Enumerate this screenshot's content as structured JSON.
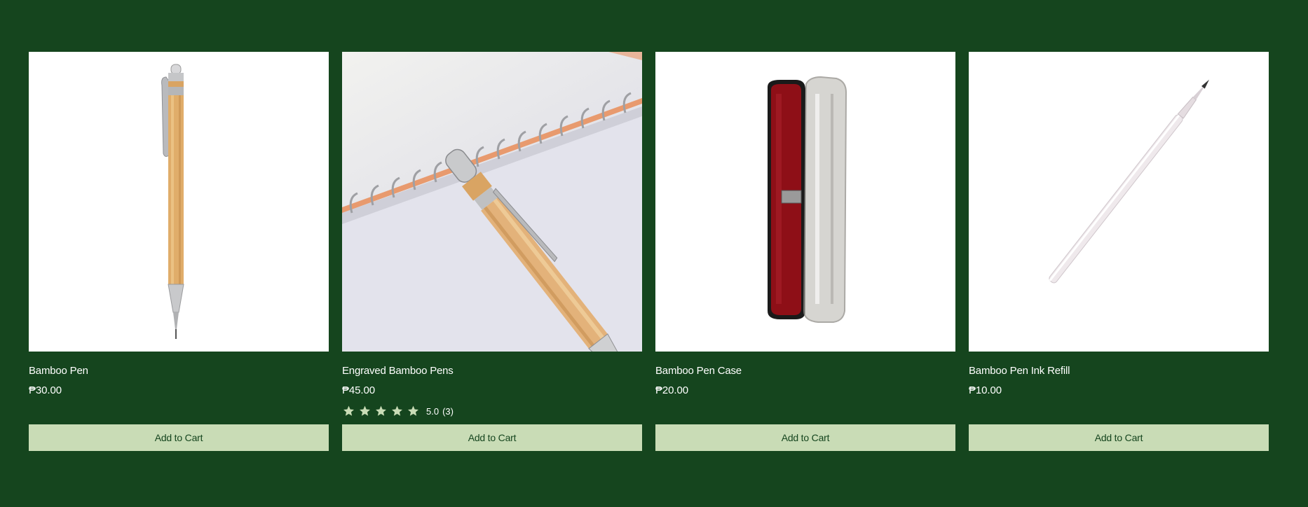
{
  "products": [
    {
      "name": "Bamboo Pen",
      "price": "₱30.00",
      "image": "bamboo-pen-image",
      "cart_label": "Add to Cart"
    },
    {
      "name": "Engraved Bamboo Pens",
      "price": "₱45.00",
      "image": "engraved-bamboo-pen-image",
      "rating": {
        "stars": 5,
        "score": "5.0",
        "count": "(3)"
      },
      "cart_label": "Add to Cart"
    },
    {
      "name": "Bamboo Pen Case",
      "price": "₱20.00",
      "image": "pen-case-image",
      "cart_label": "Add to Cart"
    },
    {
      "name": "Bamboo Pen Ink Refill",
      "price": "₱10.00",
      "image": "ink-refill-image",
      "cart_label": "Add to Cart"
    }
  ],
  "colors": {
    "background": "#15451e",
    "button": "#c9dcb6",
    "star": "#c9dcb6",
    "text": "#ffffff"
  }
}
